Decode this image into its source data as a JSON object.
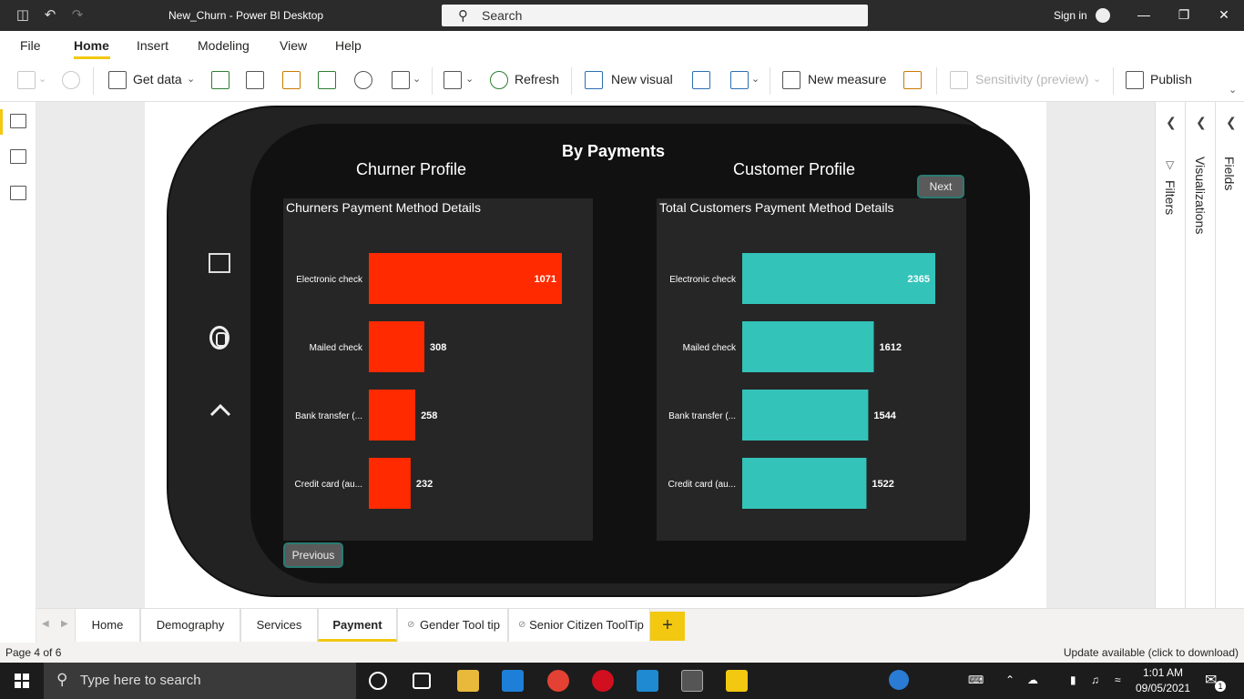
{
  "titlebar": {
    "title": "New_Churn - Power BI Desktop",
    "search_label": "Search",
    "signin_label": "Sign in"
  },
  "menu": {
    "items": [
      "File",
      "Home",
      "Insert",
      "Modeling",
      "View",
      "Help"
    ],
    "active": "Home"
  },
  "ribbon": {
    "get_data": "Get data",
    "refresh": "Refresh",
    "new_visual": "New visual",
    "new_measure": "New measure",
    "sensitivity": "Sensitivity (preview)",
    "publish": "Publish"
  },
  "report": {
    "title": "By Payments",
    "churner_profile": "Churner Profile",
    "customer_profile": "Customer Profile",
    "next_label": "Next",
    "previous_label": "Previous"
  },
  "chart_data": [
    {
      "type": "bar",
      "orientation": "horizontal",
      "title": "Churners Payment Method Details",
      "categories": [
        "Electronic check",
        "Mailed check",
        "Bank transfer (...",
        "Credit card (au..."
      ],
      "values": [
        1071,
        308,
        258,
        232
      ],
      "color": "#ff2a00",
      "data_labels": true,
      "background": "#262626"
    },
    {
      "type": "bar",
      "orientation": "horizontal",
      "title": "Total Customers Payment Method Details",
      "categories": [
        "Electronic check",
        "Mailed check",
        "Bank transfer (...",
        "Credit card (au..."
      ],
      "values": [
        2365,
        1612,
        1544,
        1522
      ],
      "color": "#33c3b9",
      "data_labels": true,
      "background": "#262626"
    }
  ],
  "rightpane": {
    "filters": "Filters",
    "visualizations": "Visualizations",
    "fields": "Fields"
  },
  "tabs": {
    "items": [
      "Home",
      "Demography",
      "Services",
      "Payment",
      "Gender Tool tip",
      "Senior Citizen ToolTip"
    ],
    "active": "Payment",
    "add": "+"
  },
  "status": {
    "page": "Page 4 of 6",
    "update": "Update available (click to download)"
  },
  "taskbar": {
    "search_placeholder": "Type here to search",
    "time": "1:01 AM",
    "date": "09/05/2021",
    "notification_count": "1"
  },
  "colors": {
    "accent": "#f2c811",
    "churn_bar": "#ff2a00",
    "customer_bar": "#33c3b9"
  }
}
